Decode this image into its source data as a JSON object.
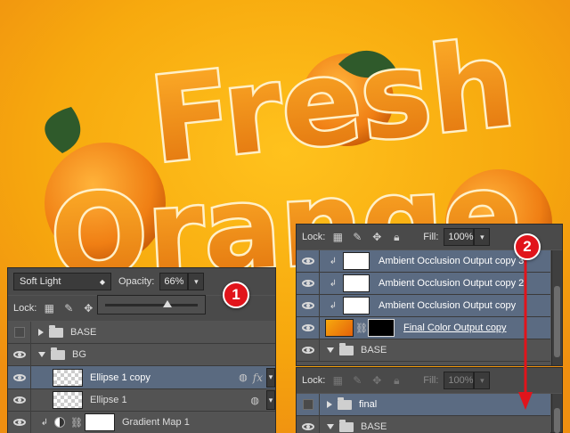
{
  "artwork": {
    "word1": "Fresh",
    "word2": "Orange",
    "colors": {
      "bg_top": "#f7a90e",
      "bg_bottom": "#f39a1a",
      "orange": "#f08a16",
      "rind": "#fff3d0",
      "leaf": "#2f5a2b"
    }
  },
  "left_panel": {
    "blend_mode": "Soft Light",
    "opacity_label": "Opacity:",
    "opacity_value": "66%",
    "lock_label": "Lock:",
    "slider_value": 0.66,
    "layers": [
      {
        "name": "BASE",
        "type": "group",
        "visible": false,
        "expanded": false
      },
      {
        "name": "BG",
        "type": "group",
        "visible": true,
        "expanded": true
      },
      {
        "name": "Ellipse 1 copy",
        "type": "shape",
        "visible": true,
        "selected": true,
        "fx": "fx"
      },
      {
        "name": "Ellipse 1",
        "type": "shape",
        "visible": true,
        "selected": false
      },
      {
        "name": "Gradient Map 1",
        "type": "adjustment",
        "visible": true,
        "selected": false
      }
    ]
  },
  "right_panel_top": {
    "lock_label": "Lock:",
    "fill_label": "Fill:",
    "fill_value": "100%",
    "layers": [
      {
        "name": "Ambient Occlusion Output copy 3",
        "visible": true
      },
      {
        "name": "Ambient Occlusion Output copy 2",
        "visible": true
      },
      {
        "name": "Ambient Occlusion Output copy",
        "visible": true
      },
      {
        "name": "Final Color Output copy",
        "visible": true
      },
      {
        "name": "BASE",
        "type": "group",
        "visible": true
      }
    ]
  },
  "right_panel_bottom": {
    "lock_label": "Lock:",
    "fill_label": "Fill:",
    "fill_value": "100%",
    "layers": [
      {
        "name": "final",
        "type": "group",
        "visible": false,
        "selected": true
      },
      {
        "name": "BASE",
        "type": "group",
        "visible": true
      }
    ]
  },
  "callouts": [
    "1",
    "2"
  ],
  "accent": "#e1141b"
}
